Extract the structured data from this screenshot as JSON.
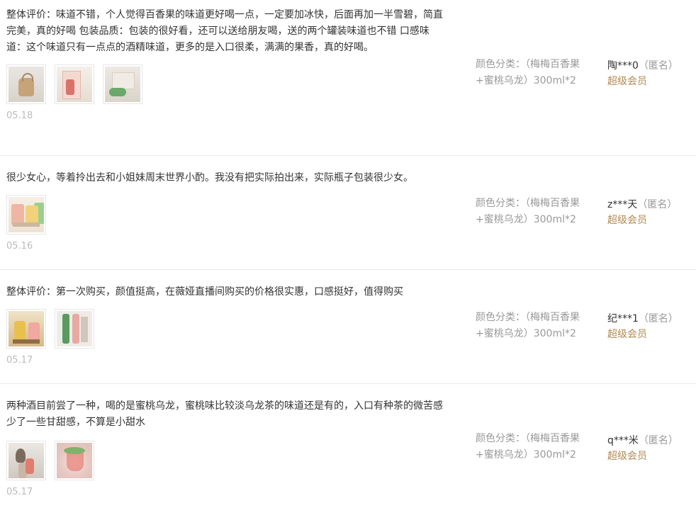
{
  "reviews": [
    {
      "text": "整体评价：味道不错，个人觉得百香果的味道更好喝一点，一定要加冰快，后面再加一半雪碧，简直完美，真的好喝 包装品质：包装的很好看，还可以送给朋友喝，送的两个罐装味道也不错 口感味道：这个味道只有一点点的酒精味道，更多的是入口很柔，满满的果香，真的好喝。",
      "photos": [
        "photo-bag",
        "photo-box",
        "photo-can"
      ],
      "date": "05.18",
      "sku_label": "颜色分类：",
      "sku_value": "（梅梅百香果+蜜桃乌龙）300ml*2",
      "user": "陶***0",
      "anon": "（匿名）",
      "vip": "超级会员"
    },
    {
      "text": "很少女心，等着拎出去和小姐妹周末世界小酌。我没有把实际拍出来，实际瓶子包装很少女。",
      "photos": [
        "photo-set"
      ],
      "date": "05.16",
      "sku_label": "颜色分类：",
      "sku_value": "（梅梅百香果+蜜桃乌龙）300ml*2",
      "user": "z***天",
      "anon": "（匿名）",
      "vip": "超级会员"
    },
    {
      "text": "整体评价：第一次购买，颜值挺高，在薇娅直播间购买的价格很实惠，口感挺好，值得购买",
      "photos": [
        "photo-yellow",
        "photo-green"
      ],
      "date": "05.17",
      "sku_label": "颜色分类：",
      "sku_value": "（梅梅百香果+蜜桃乌龙）300ml*2",
      "user": "纪***1",
      "anon": "（匿名）",
      "vip": "超级会员"
    },
    {
      "text": "两种酒目前尝了一种，喝的是蜜桃乌龙，蜜桃味比较淡乌龙茶的味道还是有的，入口有种茶的微苦感少了一些甘甜感，不算是小甜水",
      "photos": [
        "photo-room",
        "photo-drink"
      ],
      "date": "05.17",
      "sku_label": "颜色分类：",
      "sku_value": "（梅梅百香果+蜜桃乌龙）300ml*2",
      "user": "q***米",
      "anon": "（匿名）",
      "vip": "超级会员"
    }
  ],
  "colors": {
    "text": "#333333",
    "muted": "#999999",
    "date": "#bbbbbb",
    "vip": "#b08a52",
    "divider": "#e8e8e8"
  }
}
